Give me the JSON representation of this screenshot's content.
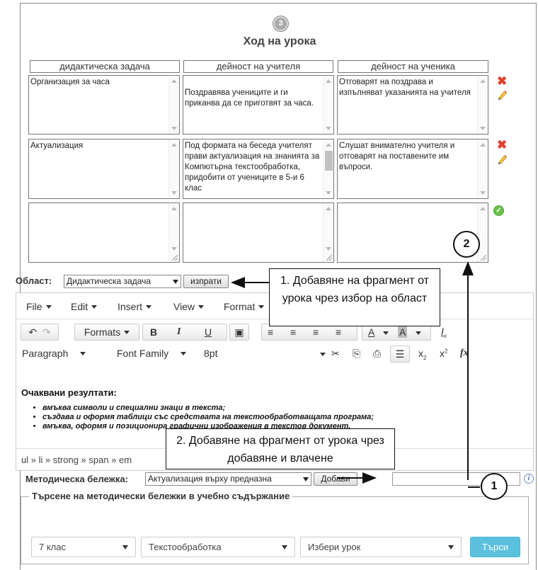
{
  "step": {
    "number": "3",
    "title": "Ход на урока"
  },
  "columns": [
    "дидактическа задача",
    "дейност на учителя",
    "дейност на ученика"
  ],
  "rows": [
    {
      "task": "Организация за часа",
      "teacher": "Поздравява учениците и ги приканва да се приготвят за часа.",
      "student": "Отговарят на поздрава и изпълняват указанията на учителя"
    },
    {
      "task": "Актуализация",
      "teacher": "Под формата на беседа учителят прави актуализация на знанията за Компютърна текстообработка, придобити от учениците в 5-и 6 клас",
      "student": "Слушат внимателно учителя и отговарят на поставените им въпроси."
    },
    {
      "task": "",
      "teacher": "",
      "student": ""
    }
  ],
  "area": {
    "label": "Област:",
    "selected": "Дидактическа задача",
    "send_label": "изпрати"
  },
  "callouts": {
    "one": "1. Добавяне на фрагмент от урока чрез избор на област",
    "two": "2. Добавяне на фрагмент от урока чрез добавяне и влачене",
    "marker1": "1",
    "marker2": "2"
  },
  "editor": {
    "menu": [
      "File",
      "Edit",
      "Insert",
      "View",
      "Format"
    ],
    "toolbar1": {
      "formats": "Formats",
      "bold": "B",
      "italic": "I",
      "underline": "U"
    },
    "toolbar2": {
      "paragraph": "Paragraph",
      "font_family": "Font Family",
      "font_size": "8pt",
      "fx": "fx"
    },
    "content_heading": "Очаквани резултати:",
    "content_items": [
      "вмъква символи и специални знаци в текста;",
      "създава и оформя таблици със средствата на текстообработващата програма;",
      "вмъква, оформя и позиционира графични изображения в текстов документ."
    ],
    "status_path": "ul » li » strong » span » em"
  },
  "method_note": {
    "label": "Методическа бележка:",
    "selected": "Актуализация върху предназна",
    "add_label": "Добави",
    "input_value": ""
  },
  "search": {
    "legend": "Търсене на методически бележки в учебно съдържание",
    "grade": "7 клас",
    "subject": "Текстообработка",
    "lesson": "Избери урок",
    "button": "Търси"
  },
  "colors": {
    "accent": "#5bc0de",
    "delete": "#e0402a",
    "ok": "#6cc24a"
  }
}
